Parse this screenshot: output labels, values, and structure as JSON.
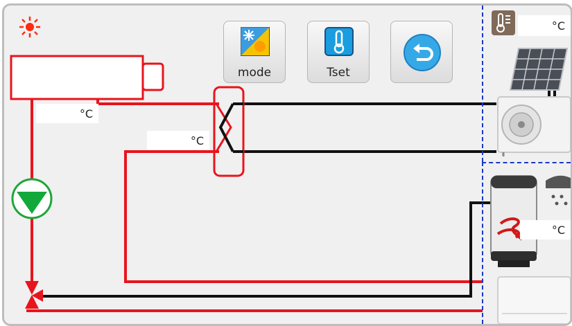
{
  "toolbar": {
    "mode_label": "mode",
    "tset_label": "Tset"
  },
  "temperatures": {
    "unit": "°C",
    "indoor_unit_supply": "°C",
    "heat_exchanger_return": "°C",
    "outdoor_ambient": "°C",
    "dhw_tank": "°C"
  },
  "icons": {
    "mode": "sun-snowflake-icon",
    "tset": "thermometer-icon",
    "back": "back-arrow-icon",
    "status": "sun-icon",
    "outdoor": "thermometer-panel-icon",
    "shower": "shower-icon"
  },
  "colors": {
    "hot_pipe": "#e8141c",
    "cold_pipe": "#111111",
    "pump": "#1fa53a",
    "zone_border": "#1838c8",
    "status_sun": "#ff2a10"
  }
}
